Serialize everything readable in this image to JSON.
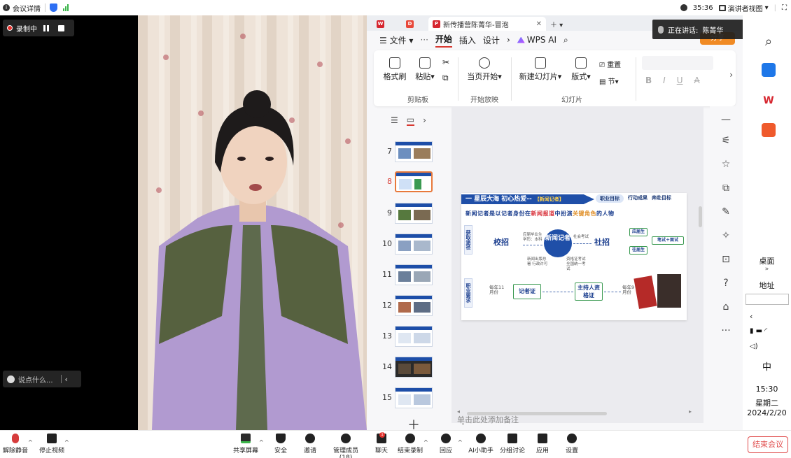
{
  "topbar": {
    "meeting_info": "会议详情",
    "time": "35:36",
    "presenter_view": "演讲者视图"
  },
  "recording": {
    "label": "录制中"
  },
  "chat": {
    "placeholder": "说点什么..."
  },
  "video": {
    "ime_chars": [
      "中",
      "🐭",
      "☀"
    ]
  },
  "speaking": {
    "prefix": "正在讲话:",
    "name": "陈菁华"
  },
  "app": {
    "tab_title": "新传播营陈菁华-冒泡",
    "menu": {
      "file": "文件",
      "more": "···",
      "start": "开始",
      "insert": "插入",
      "design": "设计",
      "wps_ai": "WPS AI"
    },
    "share_button": "分享",
    "ribbon": {
      "format_painter": "格式刷",
      "paste": "粘贴",
      "clipboard_group": "剪贴板",
      "play_current": "当页开始",
      "slideshow_group": "开始放映",
      "new_slide": "新建幻灯片",
      "layout": "版式",
      "section": "节",
      "reset": "重置",
      "slides_group": "幻灯片",
      "bold": "B",
      "italic": "I",
      "underline": "U",
      "strike": "A"
    },
    "slide_numbers": [
      "7",
      "8",
      "9",
      "10",
      "11",
      "12",
      "13",
      "14",
      "15"
    ],
    "selected_slide": "8",
    "notes_placeholder": "单击此处添加备注",
    "slide": {
      "header": "一 星辰大海 初心热爱--",
      "header_tag": "【新闻记者】",
      "tabs": [
        "职业目标",
        "行动成果",
        "奔赴目标"
      ],
      "tagline_a": "新闻记者是以记者身份在",
      "tagline_b": "新闻报道",
      "tagline_c": "中扮演",
      "tagline_d": "关键角色",
      "tagline_e": "的人物",
      "side_top": "获取途径",
      "side_bottom": "职业要求",
      "campus": "校招",
      "social": "社招",
      "center": "新闻记者",
      "reporter_card": "记者证",
      "host_cert": "主持人资格证",
      "month_nov": "每年11月份",
      "month_sep": "每年9月份",
      "exam": "笔试＋面试",
      "reg": "应届生",
      "past": "往届生",
      "campus_note": "应届毕业生 学历：本科",
      "social_note": "社会考试",
      "reporter_note": "新闻出版总署 行政许可",
      "host_note": "资格证考试 全国统一考试"
    }
  },
  "taskbar": {
    "desktop": "桌面",
    "address": "地址",
    "ime": "中",
    "time": "15:30",
    "weekday": "星期二",
    "date": "2024/2/20"
  },
  "bottombar": {
    "unmute": "解除静音",
    "stop_video": "停止视频",
    "share_screen": "共享屏幕",
    "security": "安全",
    "invite": "邀请",
    "members": "管理成员(18)",
    "chat": "聊天",
    "end_record": "结束录制",
    "reply": "回应",
    "ai": "AI小助手",
    "breakout": "分组讨论",
    "apps": "应用",
    "settings": "设置",
    "end_meeting": "结束会议",
    "chat_badge": "1"
  },
  "colors": {
    "accent_red": "#d83931",
    "wps_blue": "#1f4fa8",
    "record_red": "#e5322d",
    "signal_green": "#3bb54a"
  }
}
